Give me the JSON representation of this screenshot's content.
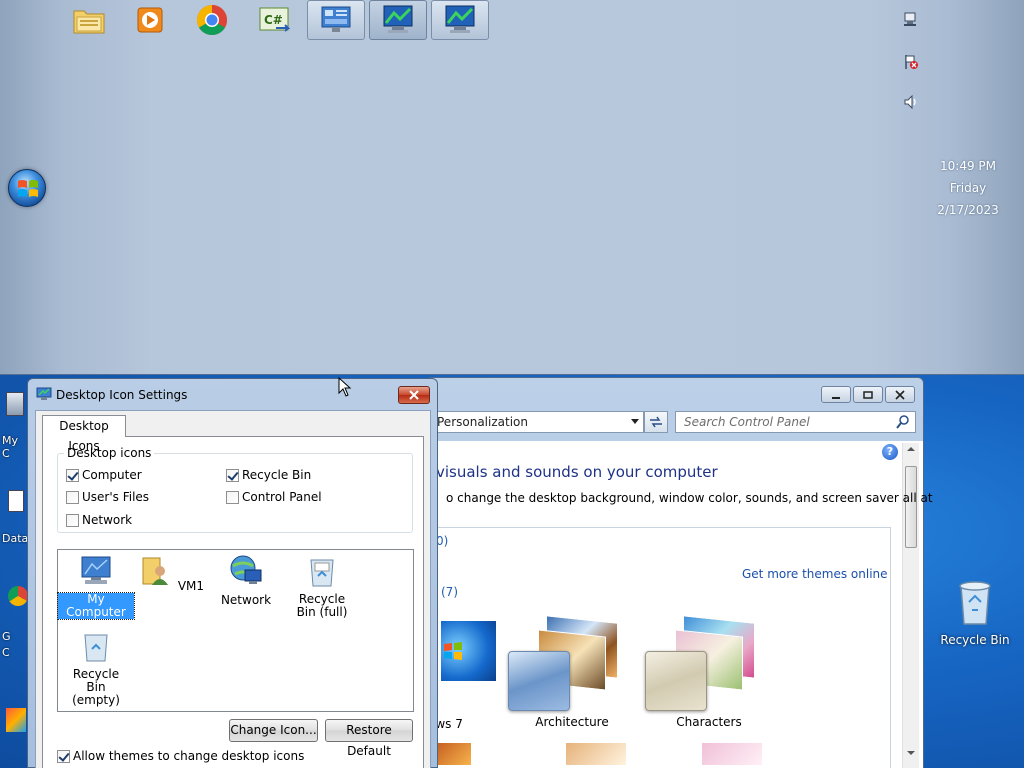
{
  "taskbar": {
    "pinned_apps": [
      {
        "name": "File Explorer"
      },
      {
        "name": "Windows Media Player"
      },
      {
        "name": "Google Chrome"
      },
      {
        "name": "C# Program"
      },
      {
        "name": "Control Panel"
      },
      {
        "name": "Remote Desktop 1"
      },
      {
        "name": "Remote Desktop 2"
      }
    ],
    "clock": {
      "time": "10:49 PM",
      "day": "Friday",
      "date": "2/17/2023"
    }
  },
  "desktop": {
    "left_fragments": [
      "My C",
      "Data",
      "G",
      "C"
    ],
    "recycle_bin_label": "Recycle Bin"
  },
  "control_panel": {
    "address": "Personalization",
    "search_placeholder": "Search Control Panel",
    "help": "?",
    "heading": "visuals and sounds on your computer",
    "description": "o change the desktop background, window color, sounds, and screen saver all at",
    "frag_count1": "0)",
    "frag_count2": "(7)",
    "get_more_link": "Get more themes online",
    "themes": [
      {
        "label": "ows 7"
      },
      {
        "label": "Architecture"
      },
      {
        "label": "Characters"
      }
    ]
  },
  "dialog": {
    "title": "Desktop Icon Settings",
    "tab_label": "Desktop Icons",
    "group_title": "Desktop icons",
    "checkboxes": [
      {
        "label": "Computer",
        "checked": true
      },
      {
        "label": "Recycle Bin",
        "checked": true
      },
      {
        "label": "User's Files",
        "checked": false
      },
      {
        "label": "Control Panel",
        "checked": false
      },
      {
        "label": "Network",
        "checked": false
      }
    ],
    "icons": [
      {
        "label": "My Computer",
        "selected": true
      },
      {
        "label": "VM1",
        "selected": false
      },
      {
        "label": "Network",
        "selected": false
      },
      {
        "label": "Recycle Bin (full)",
        "selected": false
      },
      {
        "label": "Recycle Bin (empty)",
        "selected": false
      }
    ],
    "change_icon_button": "Change Icon...",
    "restore_default_button": "Restore Default",
    "allow_themes_label": "Allow themes to change desktop icons",
    "allow_themes_checked": true
  },
  "colors": {
    "accent": "#3399ff",
    "link": "#1b4fad",
    "heading": "#1e3287",
    "desktop": "#1766c4"
  }
}
